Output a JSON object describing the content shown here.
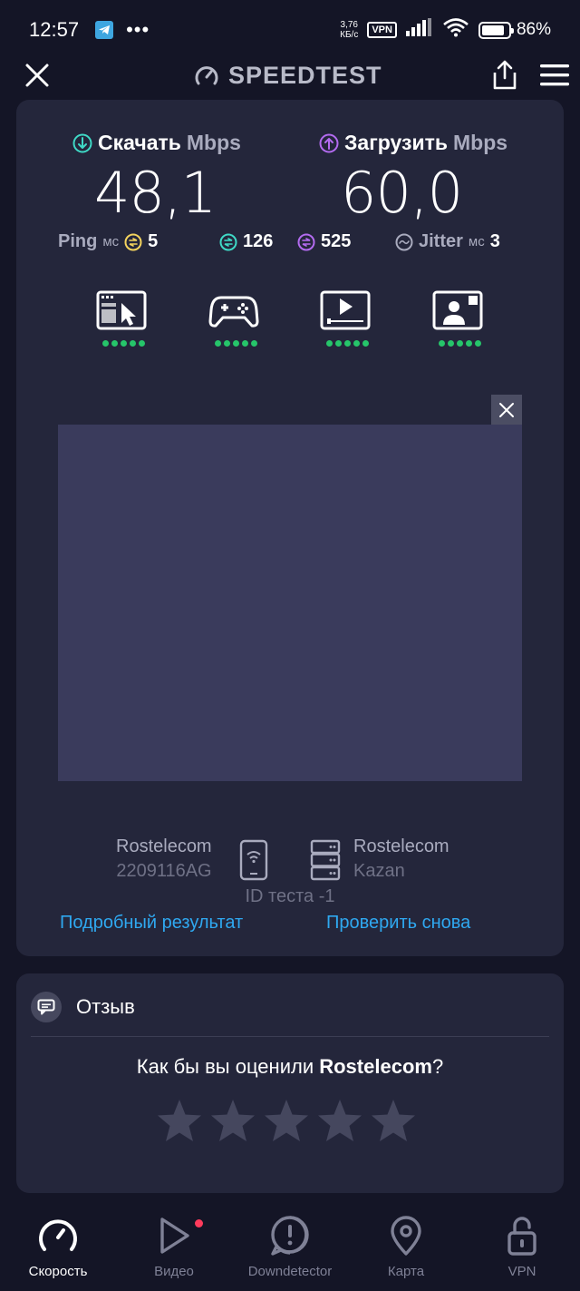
{
  "status": {
    "time": "12:57",
    "net_speed_top": "3,76",
    "net_speed_bottom": "КБ/с",
    "vpn": "VPN",
    "battery": "86%",
    "battery_level": 0.86
  },
  "header": {
    "brand": "SPEEDTEST"
  },
  "download": {
    "label": "Скачать",
    "unit": "Mbps",
    "value": "48,1"
  },
  "upload": {
    "label": "Загрузить",
    "unit": "Mbps",
    "value": "60,0"
  },
  "ping": {
    "label": "Ping",
    "unit": "мс",
    "idle": "5",
    "download": "126",
    "upload": "525",
    "jitter_label": "Jitter",
    "jitter_unit": "мс",
    "jitter": "3"
  },
  "apps": [
    {
      "name": "web-browsing",
      "icon": "browser-cursor-icon",
      "rating": 5
    },
    {
      "name": "gaming",
      "icon": "gamepad-icon",
      "rating": 5
    },
    {
      "name": "video-streaming",
      "icon": "video-player-icon",
      "rating": 5
    },
    {
      "name": "video-chat",
      "icon": "video-call-icon",
      "rating": 5
    }
  ],
  "device": {
    "isp": "Rostelecom",
    "model": "2209116AG"
  },
  "server": {
    "name": "Rostelecom",
    "city": "Kazan"
  },
  "test_id": "ID теста -1",
  "links": {
    "details": "Подробный результат",
    "retry": "Проверить снова"
  },
  "review": {
    "title": "Отзыв",
    "question_prefix": "Как бы вы оценили ",
    "question_isp": "Rostelecom",
    "question_suffix": "?"
  },
  "nav": [
    {
      "label": "Скорость",
      "icon": "speed-gauge-icon",
      "active": true
    },
    {
      "label": "Видео",
      "icon": "play-icon",
      "active": false
    },
    {
      "label": "Downdetector",
      "icon": "alert-icon",
      "active": false
    },
    {
      "label": "Карта",
      "icon": "map-pin-icon",
      "active": false
    },
    {
      "label": "VPN",
      "icon": "lock-icon",
      "active": false
    }
  ],
  "colors": {
    "background": "#141526",
    "card": "#24263b",
    "accent_download": "#3fd9c6",
    "accent_upload": "#b36bf0",
    "ping_idle": "#f4d35e",
    "link": "#2fa8f0",
    "rating_dot": "#26c56a"
  }
}
